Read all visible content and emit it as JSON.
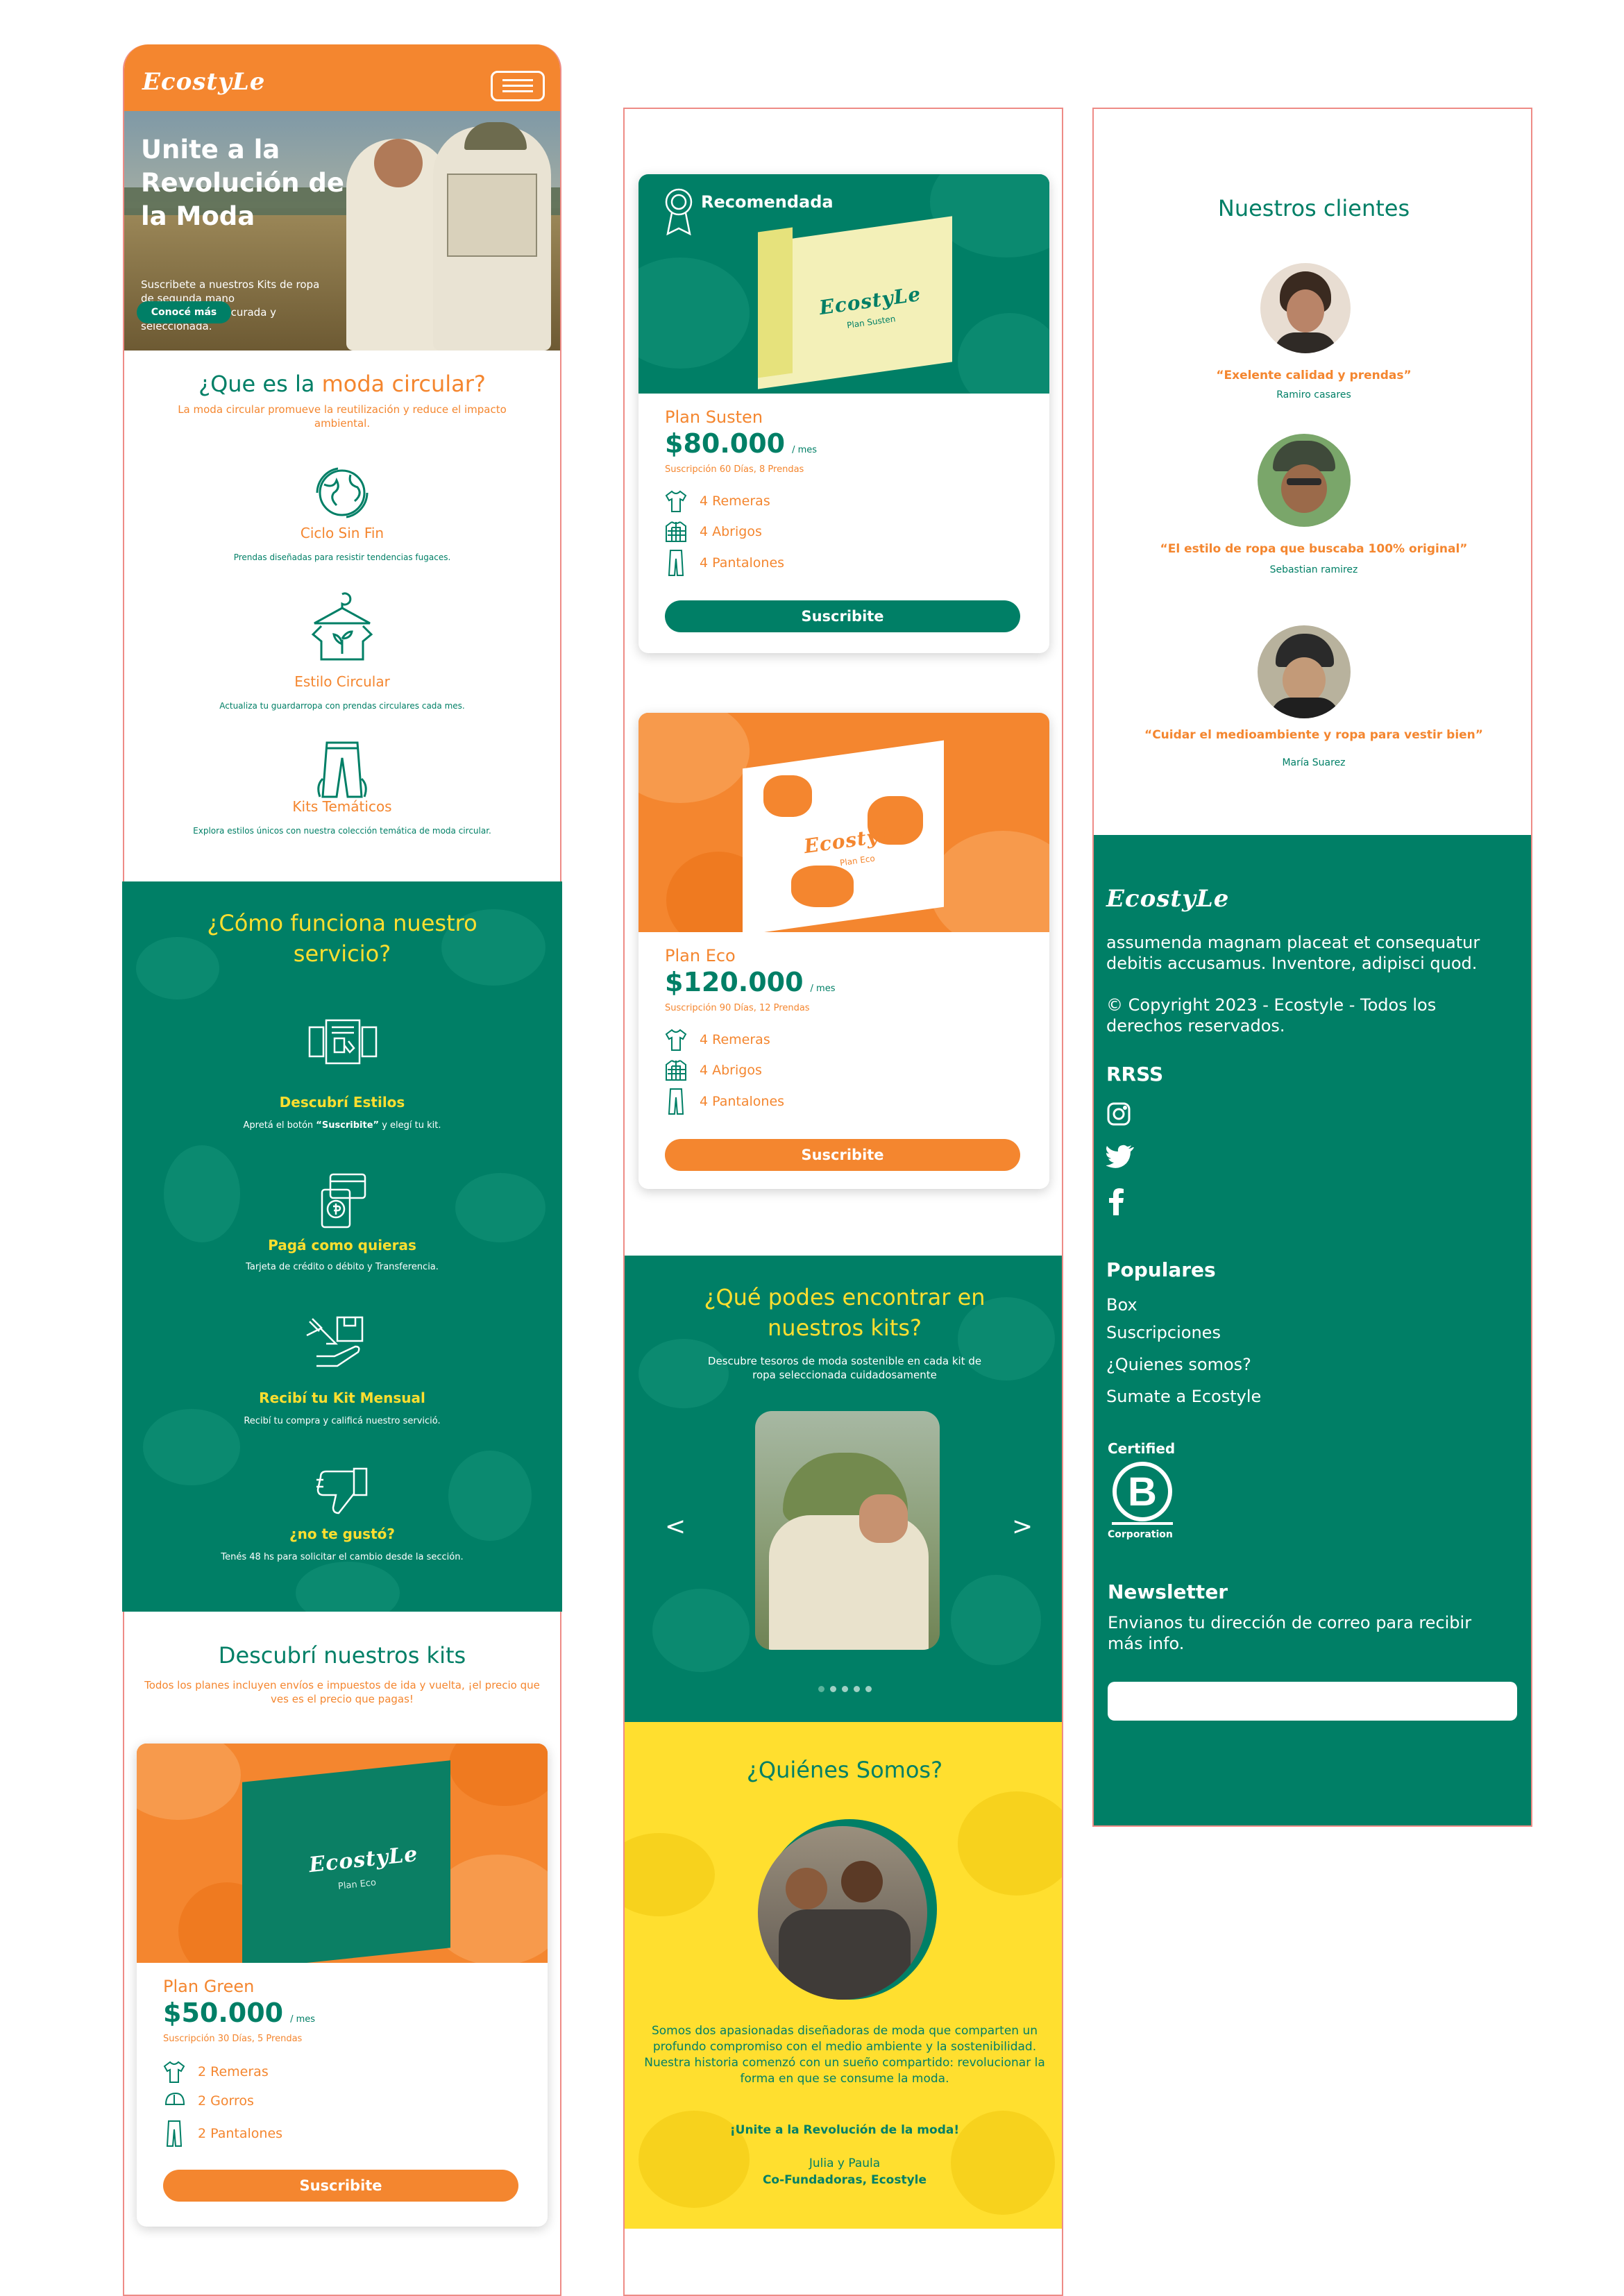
{
  "brand": {
    "logo": "EcostyLe",
    "colors": {
      "green": "#007f66",
      "orange": "#f4862f",
      "yellow": "#ffdf2f"
    }
  },
  "hero": {
    "title_lines": [
      "Unite a la",
      "Revolución de",
      "la Moda"
    ],
    "subtitle": "Suscribete a nuestros Kits de ropa de segunda mano cuidadosamente curada y seleccionada.",
    "button": "Conocé más"
  },
  "circular": {
    "title_a": "¿Que es la ",
    "title_b": "moda circular?",
    "subtitle": "La moda circular promueve la reutilización y reduce el impacto ambiental.",
    "features": [
      {
        "icon": "globe-cycle-icon",
        "title": "Ciclo Sin Fin",
        "desc": "Prendas diseñadas para resistir tendencias fugaces."
      },
      {
        "icon": "hanger-shirt-icon",
        "title": "Estilo Circular",
        "desc": "Actualiza tu guardarropa con prendas circulares cada mes."
      },
      {
        "icon": "pants-icon",
        "title": "Kits Temáticos",
        "desc": "Explora estilos únicos con nuestra colección temática de moda circular."
      }
    ]
  },
  "how": {
    "title": "¿Cómo funciona nuestro servicio?",
    "steps": [
      {
        "icon": "browse-styles-icon",
        "title": "Descubrí Estilos",
        "desc_a": "Apretá el botón ",
        "desc_b": "“Suscribite”",
        "desc_c": " y elegí tu kit."
      },
      {
        "icon": "card-payment-icon",
        "title": "Pagá como quieras",
        "desc_a": "Tarjeta de crédito o débito y Transferencia.",
        "desc_b": "",
        "desc_c": ""
      },
      {
        "icon": "package-hand-icon",
        "title": "Recibí tu Kit Mensual",
        "desc_a": "Recibí tu compra y calificá nuestro servició.",
        "desc_b": "",
        "desc_c": ""
      },
      {
        "icon": "thumbs-down-icon",
        "title": "¿no te gustó?",
        "desc_a": "Tenés 48 hs para solicitar el cambio desde la sección.",
        "desc_b": "",
        "desc_c": ""
      }
    ]
  },
  "kits": {
    "title": "Descubrí nuestros kits",
    "subtitle": "Todos los planes incluyen envíos e impuestos de ida y vuelta, ¡el precio que ves es el precio que pagas!"
  },
  "plans": [
    {
      "box_label": "Plan Eco",
      "name": "Plan Green",
      "price": "$50.000",
      "per": "/ mes",
      "detail": "Suscripción 30 Días,  5 Prendas",
      "items": [
        "2 Remeras",
        "2 Gorros",
        "2 Pantalones"
      ],
      "button": "Suscribite"
    },
    {
      "badge": "Recomendada",
      "box_label": "Plan Susten",
      "name": "Plan Susten",
      "price": "$80.000",
      "per": "/ mes",
      "detail": "Suscripción 60 Días, 8 Prendas",
      "items": [
        "4 Remeras",
        "4 Abrigos",
        "4 Pantalones"
      ],
      "button": "Suscribite"
    },
    {
      "box_label": "Plan Eco",
      "name": "Plan Eco",
      "price": "$120.000",
      "per": "/ mes",
      "detail": "Suscripción 90 Días,  12 Prendas",
      "items": [
        "4 Remeras",
        "4 Abrigos",
        "4 Pantalones"
      ],
      "button": "Suscribite"
    }
  ],
  "find": {
    "title": "¿Qué podes encontrar en nuestros  kits?",
    "subtitle": "Descubre tesoros de moda sostenible en cada kit de ropa seleccionada cuidadosamente",
    "prev": "<",
    "next": ">",
    "slide_count": 5
  },
  "about": {
    "title": "¿Quiénes Somos?",
    "text": "Somos dos apasionadas diseñadoras de moda que comparten un profundo compromiso con el medio ambiente y la sostenibilidad. Nuestra historia comenzó con un sueño compartido: revolucionar la forma en que se consume la moda.",
    "cta": "¡Unite a la Revolución de la  moda!",
    "names": "Julia y Paula",
    "role": "Co-Fundadoras, Ecostyle"
  },
  "clients": {
    "title": "Nuestros clientes",
    "items": [
      {
        "quote": "“Exelente calidad y prendas”",
        "name": "Ramiro casares"
      },
      {
        "quote": "“El estilo de ropa que buscaba 100% original”",
        "name": "Sebastian ramirez"
      },
      {
        "quote": "“Cuidar el medioambiente y ropa para vestir bien”",
        "name": "María  Suarez"
      }
    ]
  },
  "footer": {
    "about": "assumenda magnam placeat et consequatur debitis accusamus. Inventore, adipisci quod.",
    "copyright": "© Copyright 2023 - Ecostyle - Todos los derechos reservados.",
    "rrss_title": "RRSS",
    "social": [
      "instagram-icon",
      "twitter-icon",
      "facebook-icon"
    ],
    "popular_title": "Populares",
    "links": [
      "Box",
      "Suscripciones",
      "¿Quienes somos?",
      "Sumate a  Ecostyle"
    ],
    "bcorp_top": "Certified",
    "bcorp_bottom": "Corporation",
    "newsletter_title": "Newsletter",
    "newsletter_text": "Envianos tu dirección de correo para recibir más info.",
    "newsletter_placeholder": ""
  }
}
